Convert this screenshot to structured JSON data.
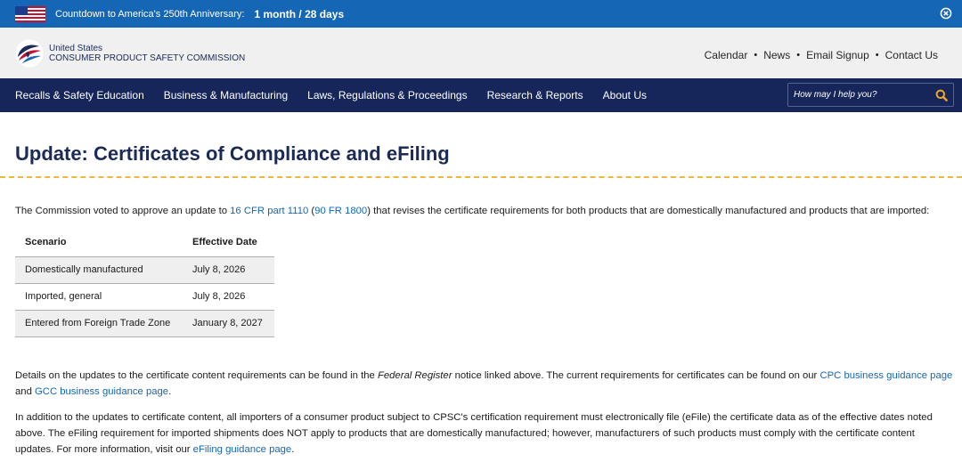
{
  "banner": {
    "label": "Countdown to America's 250th Anniversary:",
    "countdown": "1 month / 28 days"
  },
  "header": {
    "agency_line1": "United States",
    "agency_line2": "CONSUMER PRODUCT SAFETY COMMISSION",
    "utility_links": [
      "Calendar",
      "News",
      "Email Signup",
      "Contact Us"
    ],
    "separator": "•"
  },
  "nav": {
    "items": [
      "Recalls & Safety Education",
      "Business & Manufacturing",
      "Laws, Regulations & Proceedings",
      "Research & Reports",
      "About Us"
    ],
    "search_placeholder": "How may I help you?"
  },
  "page": {
    "title": "Update: Certificates of Compliance and eFiling",
    "intro": {
      "before": "The Commission voted to approve an update to ",
      "link1": "16 CFR part 1110",
      "between1": " (",
      "link2": "90 FR 1800",
      "after": ") that revises the certificate requirements for both products that are domestically manufactured and products that are imported:"
    },
    "table": {
      "headers": [
        "Scenario",
        "Effective Date"
      ],
      "rows": [
        [
          "Domestically manufactured",
          "July 8, 2026"
        ],
        [
          "Imported, general",
          "July 8, 2026"
        ],
        [
          "Entered from Foreign Trade Zone",
          "January 8, 2027"
        ]
      ]
    },
    "para1": {
      "t1": "Details on the updates to the certificate content requirements can be found in the ",
      "italic": "Federal Register",
      "t2": " notice linked above. The current requirements for certificates can be found on our ",
      "link1": "CPC business guidance page",
      "t3": " and ",
      "link2": "GCC business guidance page",
      "t4": "."
    },
    "para2": {
      "t1": "In addition to the updates to certificate content, all importers of a consumer product subject to CPSC's certification requirement must electronically file (eFile) the certificate data as of the effective dates noted above. The eFiling requirement for imported shipments does NOT apply to products that are domestically manufactured; however, manufacturers of such products must comply with the certificate content updates. For more information, visit our ",
      "link": "eFiling guidance page",
      "t2": "."
    }
  },
  "colors": {
    "banner_bg": "#1567b6",
    "nav_bg": "#16255a",
    "title": "#1b2a57",
    "link": "#1567b6",
    "rule": "#f0b63e",
    "search_icon": "#f5a623"
  },
  "icons": [
    "us-flag-icon",
    "close-icon",
    "cpsc-logo",
    "search-icon"
  ]
}
